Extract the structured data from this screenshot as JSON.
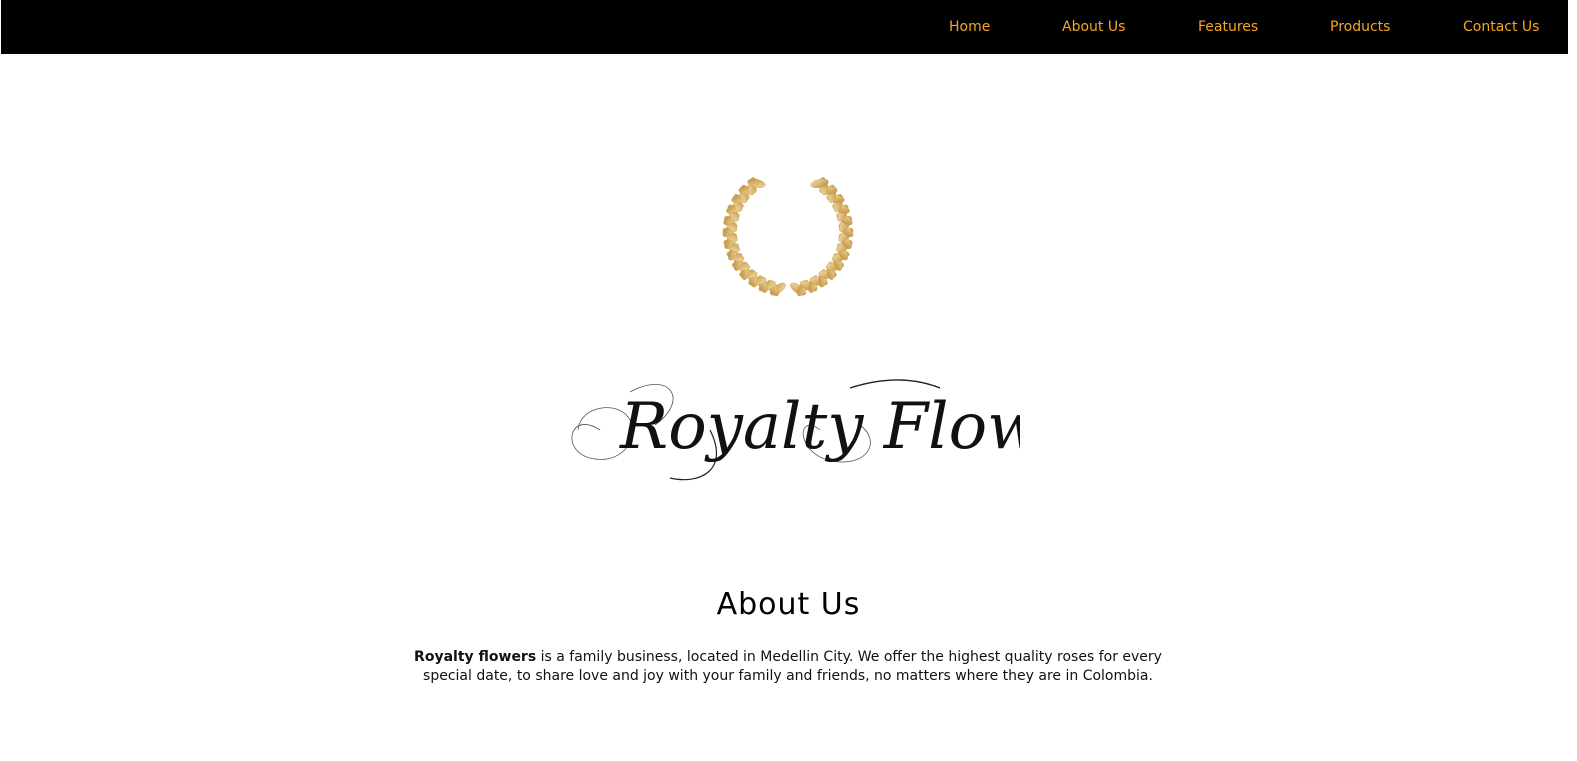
{
  "nav": {
    "items": [
      {
        "label": "Home"
      },
      {
        "label": "About Us"
      },
      {
        "label": "Features"
      },
      {
        "label": "Products"
      },
      {
        "label": "Contact Us"
      }
    ]
  },
  "logo": {
    "wordmark": "Royalty Flowers",
    "emblem_icon": "laurel-wreath-icon"
  },
  "about": {
    "title": "About Us",
    "brand_name": "Royalty flowers",
    "body": " is a family business, located in Medellin City. We offer the highest quality roses for every special date, to share love and joy with your family and friends, no matters where they are in Colombia."
  },
  "colors": {
    "nav_background": "#000000",
    "nav_link": "#f5a623",
    "wreath_gold": "#d9b36a",
    "page_background": "#ffffff"
  }
}
